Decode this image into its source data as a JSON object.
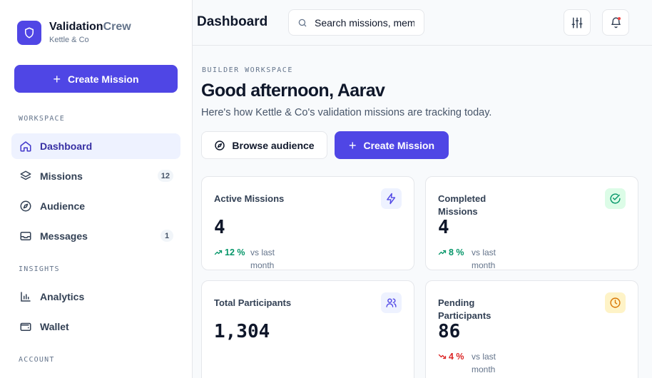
{
  "brand": {
    "name_main": "Validation",
    "name_accent": "Crew",
    "subtitle": "Kettle & Co"
  },
  "sidebar": {
    "create_label": "Create Mission",
    "sections": [
      {
        "label": "WORKSPACE"
      },
      {
        "label": "INSIGHTS"
      },
      {
        "label": "ACCOUNT"
      }
    ],
    "items": [
      {
        "label": "Dashboard",
        "icon": "home-icon",
        "active": true
      },
      {
        "label": "Missions",
        "icon": "layers-icon",
        "badge": "12"
      },
      {
        "label": "Audience",
        "icon": "compass-icon"
      },
      {
        "label": "Messages",
        "icon": "inbox-icon",
        "badge": "1"
      },
      {
        "label": "Analytics",
        "icon": "bar-chart-icon"
      },
      {
        "label": "Wallet",
        "icon": "wallet-icon"
      }
    ]
  },
  "header": {
    "title": "Dashboard",
    "search_placeholder": "Search missions, members...",
    "filter_icon": "sliders-icon",
    "notification_icon": "bell-icon"
  },
  "main": {
    "eyebrow": "BUILDER WORKSPACE",
    "greeting": "Good afternoon, Aarav",
    "lead": "Here's how Kettle & Co's validation missions are tracking today.",
    "browse_label": "Browse audience",
    "create_label": "Create Mission"
  },
  "stats": [
    {
      "title": "Active Missions",
      "value": "4",
      "trend": "12 %",
      "direction": "up",
      "note": "vs last month",
      "icon": "zap-icon",
      "accent": "#4f46e5"
    },
    {
      "title": "Completed Missions",
      "value": "4",
      "trend": "8 %",
      "direction": "up",
      "note": "vs last month",
      "icon": "check-circle-icon",
      "accent": "#059669"
    },
    {
      "title": "Total Participants",
      "value": "1,304",
      "icon": "users-icon",
      "accent": "#4f46e5"
    },
    {
      "title": "Pending Participants",
      "value": "86",
      "trend": "4 %",
      "direction": "down",
      "note": "vs last month",
      "icon": "clock-icon",
      "accent": "#d97706"
    }
  ],
  "colors": {
    "primary": "#4f46e5",
    "positive": "#059669",
    "negative": "#dc2626",
    "warning": "#d97706"
  }
}
